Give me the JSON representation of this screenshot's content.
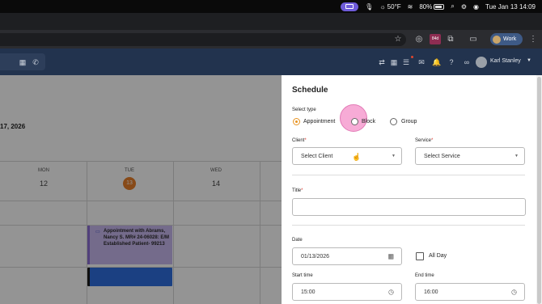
{
  "menubar": {
    "weather": "50°F",
    "battery": "80%",
    "datetime": "Tue Jan 13  14:09"
  },
  "browser": {
    "calendar_badge": "84d",
    "profile_label": "Work"
  },
  "app_header": {
    "user_name": "Karl Stanley"
  },
  "calendar": {
    "date_heading": "17, 2026",
    "days": [
      {
        "name": "MON",
        "num": "12"
      },
      {
        "name": "TUE",
        "num": "13"
      },
      {
        "name": "WED",
        "num": "14"
      }
    ],
    "appointment_text": "Appointment with Abrams, Nancy S. MR# 24-06028: E/M Established Patient- 99213"
  },
  "schedule": {
    "title": "Schedule",
    "select_type_label": "Select type",
    "types": [
      "Appointment",
      "Block",
      "Group"
    ],
    "selected_type": "Appointment",
    "client_label": "Client",
    "client_placeholder": "Select Client",
    "service_label": "Service",
    "service_placeholder": "Select Service",
    "title_label": "Title",
    "title_value": "",
    "date_label": "Date",
    "date_value": "01/13/2026",
    "all_day_label": "All Day",
    "start_label": "Start time",
    "start_value": "15:00",
    "end_label": "End time",
    "end_value": "16:00"
  },
  "colors": {
    "accent": "#e89422",
    "header_bg": "#22334e",
    "appointment_bg": "#c9b8f0",
    "highlight": "#f48fc8"
  }
}
